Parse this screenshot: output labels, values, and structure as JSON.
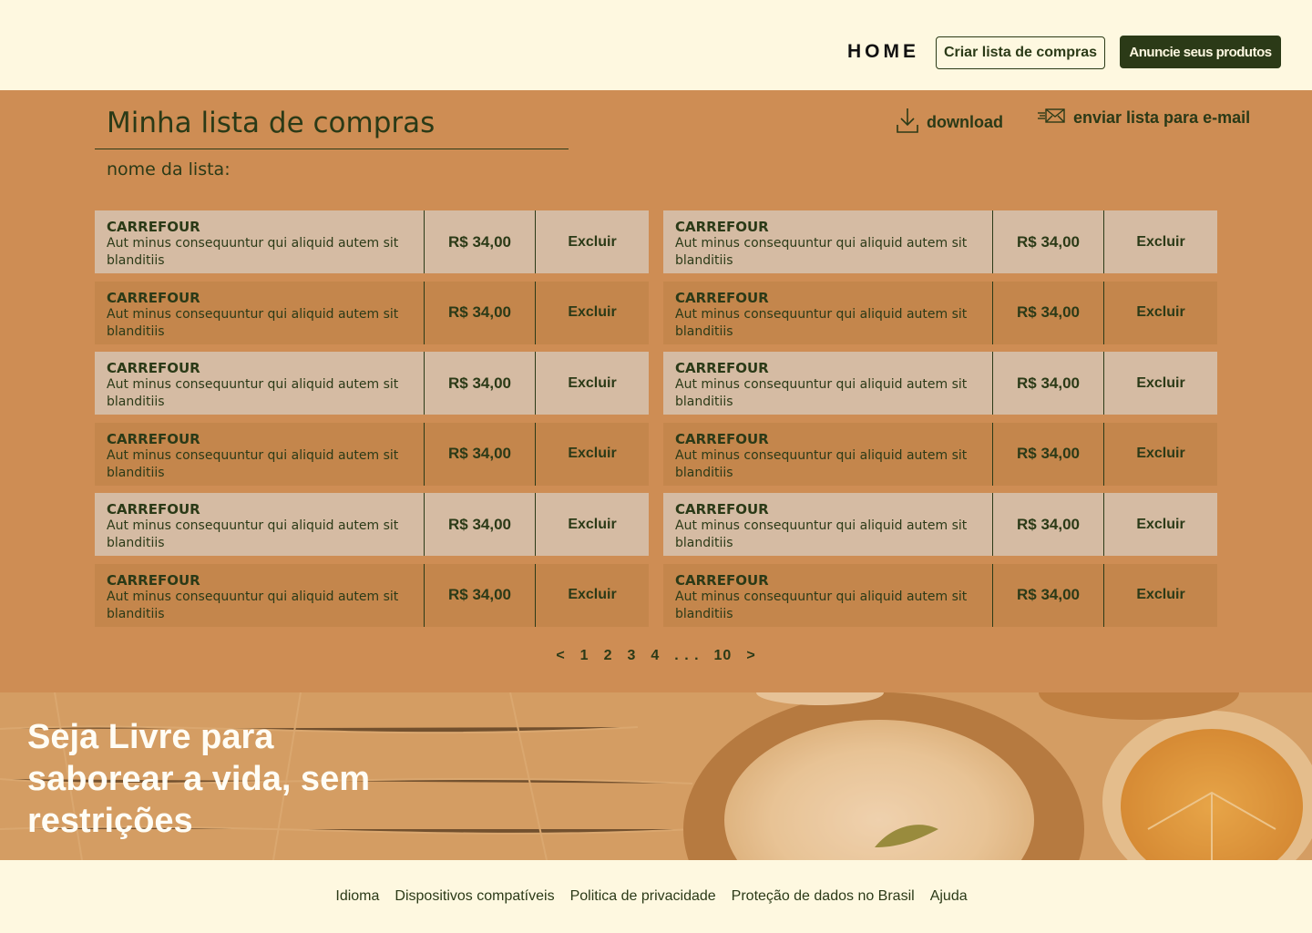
{
  "header": {
    "home_label": "HOME",
    "create_list_label": "Criar lista de compras",
    "advertise_label": "Anuncie seus produtos"
  },
  "main": {
    "title": "Minha lista de compras",
    "list_name_label": "nome da lista:",
    "download_label": "download",
    "email_label": "enviar lista para e-mail"
  },
  "items_left": [
    {
      "store": "CARREFOUR",
      "desc": "Aut minus consequuntur qui aliquid autem sit blanditiis",
      "price": "R$ 34,00",
      "delete": "Excluir"
    },
    {
      "store": "CARREFOUR",
      "desc": "Aut minus consequuntur qui aliquid autem sit blanditiis",
      "price": "R$ 34,00",
      "delete": "Excluir"
    },
    {
      "store": "CARREFOUR",
      "desc": "Aut minus consequuntur qui aliquid autem sit blanditiis",
      "price": "R$ 34,00",
      "delete": "Excluir"
    },
    {
      "store": "CARREFOUR",
      "desc": "Aut minus consequuntur qui aliquid autem sit blanditiis",
      "price": "R$ 34,00",
      "delete": "Excluir"
    },
    {
      "store": "CARREFOUR",
      "desc": "Aut minus consequuntur qui aliquid autem sit blanditiis",
      "price": "R$ 34,00",
      "delete": "Excluir"
    },
    {
      "store": "CARREFOUR",
      "desc": "Aut minus consequuntur qui aliquid autem sit blanditiis",
      "price": "R$ 34,00",
      "delete": "Excluir"
    }
  ],
  "items_right": [
    {
      "store": "CARREFOUR",
      "desc": "Aut minus consequuntur qui aliquid autem sit blanditiis",
      "price": "R$ 34,00",
      "delete": "Excluir"
    },
    {
      "store": "CARREFOUR",
      "desc": "Aut minus consequuntur qui aliquid autem sit blanditiis",
      "price": "R$ 34,00",
      "delete": "Excluir"
    },
    {
      "store": "CARREFOUR",
      "desc": "Aut minus consequuntur qui aliquid autem sit blanditiis",
      "price": "R$ 34,00",
      "delete": "Excluir"
    },
    {
      "store": "CARREFOUR",
      "desc": "Aut minus consequuntur qui aliquid autem sit blanditiis",
      "price": "R$ 34,00",
      "delete": "Excluir"
    },
    {
      "store": "CARREFOUR",
      "desc": "Aut minus consequuntur qui aliquid autem sit blanditiis",
      "price": "R$ 34,00",
      "delete": "Excluir"
    },
    {
      "store": "CARREFOUR",
      "desc": "Aut minus consequuntur qui aliquid autem sit blanditiis",
      "price": "R$ 34,00",
      "delete": "Excluir"
    }
  ],
  "pagination": {
    "prev": "<",
    "pages": [
      "1",
      "2",
      "3",
      "4",
      ". . .",
      "10"
    ],
    "next": ">"
  },
  "banner": {
    "text": "Seja Livre para saborear a vida, sem restrições"
  },
  "footer": {
    "links": [
      "Idioma",
      "Dispositivos compatíveis",
      "Politica de privacidade",
      "Proteção de dados no Brasil",
      "Ajuda"
    ]
  },
  "colors": {
    "accent": "#2b3a17",
    "background": "#fef8e0",
    "main": "#ce8d54",
    "row_light": "#d5bba3",
    "row_dark": "#c4864c"
  }
}
